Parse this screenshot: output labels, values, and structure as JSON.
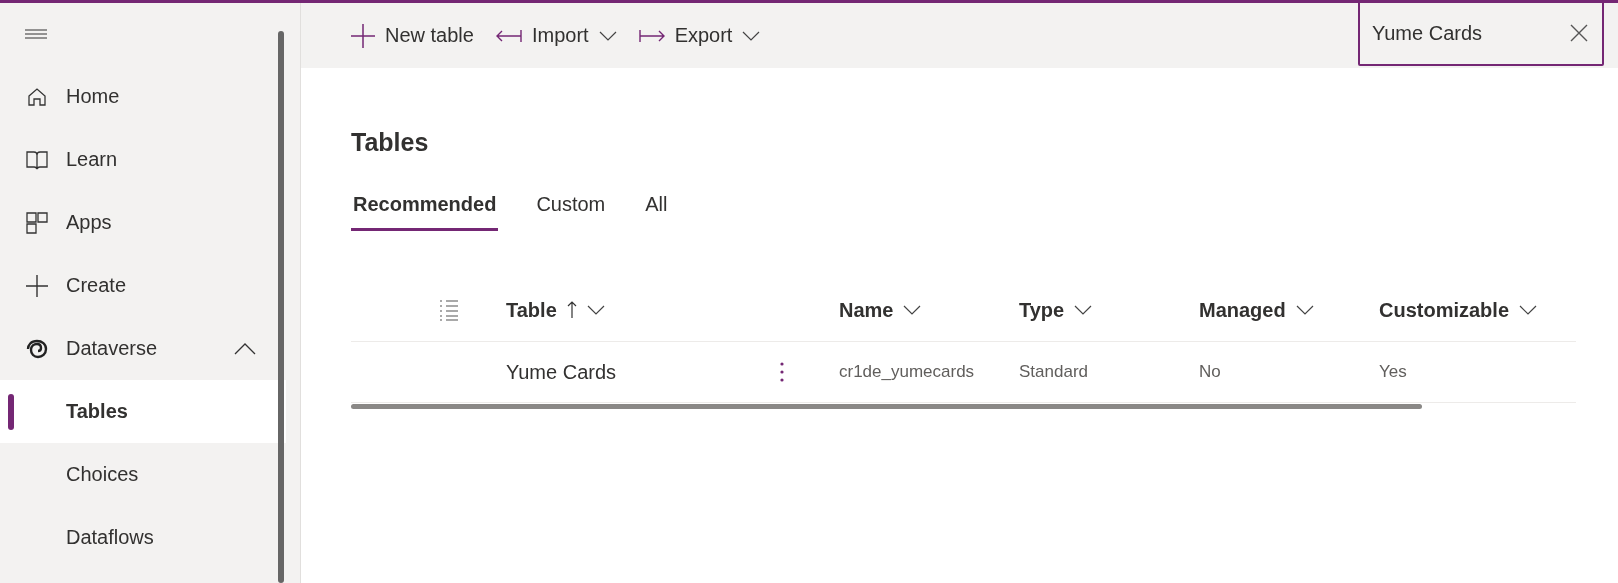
{
  "sidebar": {
    "items": [
      {
        "kind": "item",
        "label": "Home",
        "selected": false
      },
      {
        "kind": "item",
        "label": "Learn",
        "selected": false
      },
      {
        "kind": "item",
        "label": "Apps",
        "selected": false
      },
      {
        "kind": "item",
        "label": "Create",
        "selected": false
      },
      {
        "kind": "group",
        "label": "Dataverse",
        "selected": false,
        "expanded": true,
        "children": [
          {
            "kind": "sub",
            "label": "Tables",
            "selected": true
          },
          {
            "kind": "sub",
            "label": "Choices",
            "selected": false
          },
          {
            "kind": "sub",
            "label": "Dataflows",
            "selected": false
          }
        ]
      }
    ]
  },
  "toolbar": {
    "buttons": [
      {
        "label": "New table",
        "dropdown": false
      },
      {
        "label": "Import",
        "dropdown": true
      },
      {
        "label": "Export",
        "dropdown": true
      }
    ]
  },
  "search": {
    "value": "Yume Cards"
  },
  "page_title": "Tables",
  "tabs": [
    {
      "label": "Recommended",
      "selected": true
    },
    {
      "label": "Custom",
      "selected": false
    },
    {
      "label": "All",
      "selected": false
    }
  ],
  "table": {
    "columns": [
      {
        "label": "Table",
        "sorted": true
      },
      {
        "label": "Name",
        "sorted": false
      },
      {
        "label": "Type",
        "sorted": false
      },
      {
        "label": "Managed",
        "sorted": false
      },
      {
        "label": "Customizable",
        "sorted": false
      }
    ],
    "rows": [
      {
        "table": "Yume Cards",
        "name": "cr1de_yumecards",
        "type": "Standard",
        "managed": "No",
        "customizable": "Yes"
      }
    ]
  }
}
